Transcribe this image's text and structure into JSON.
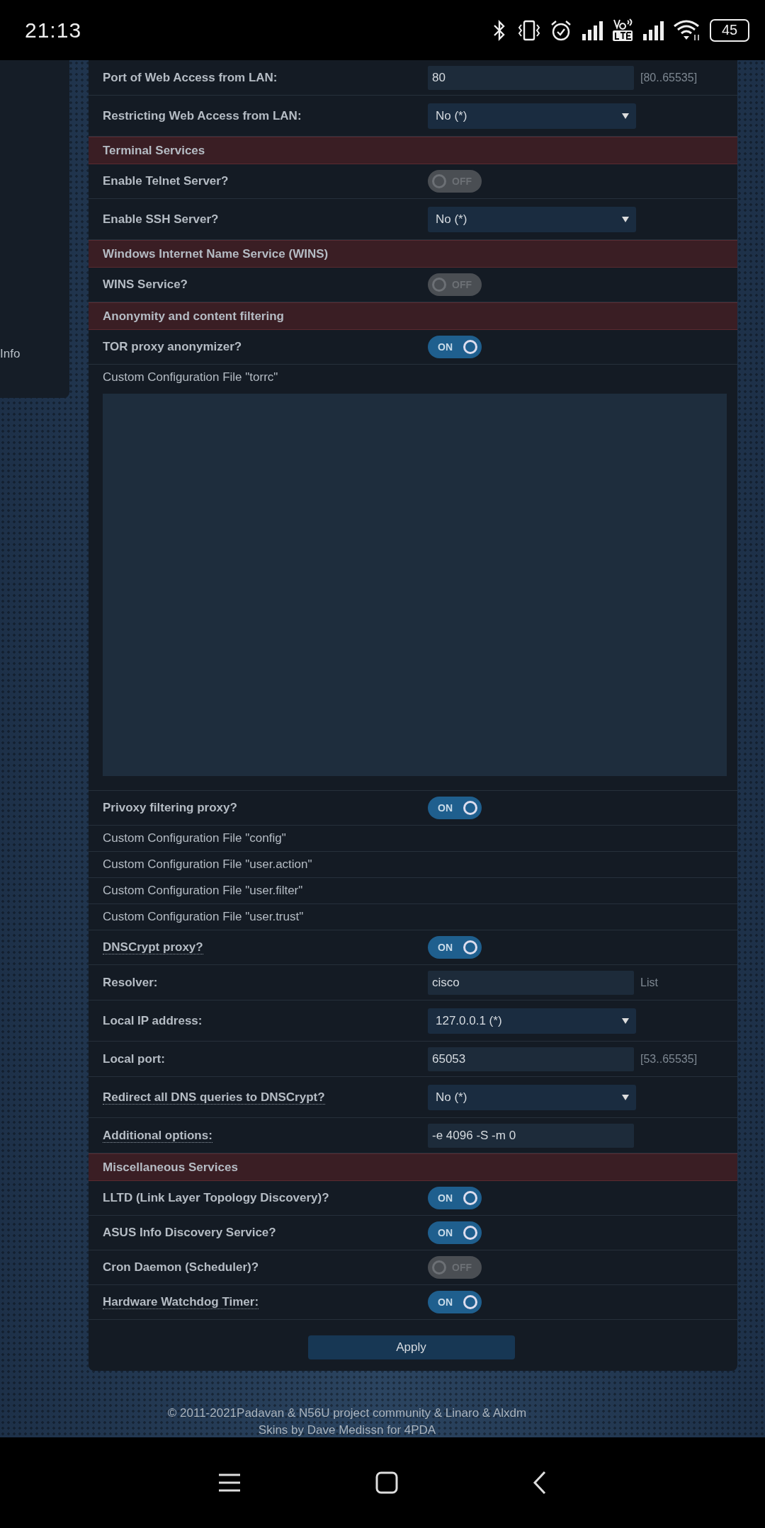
{
  "status_bar": {
    "time": "21:13",
    "battery": "45"
  },
  "sidebar": {
    "items": [
      {
        "label": "Info"
      }
    ]
  },
  "rows": [
    {
      "kind": "input",
      "label": "Port of Web Access from LAN:",
      "value": "80",
      "hint": "[80..65535]",
      "help": false
    },
    {
      "kind": "select",
      "label": "Restricting Web Access from LAN:",
      "value": "No (*)",
      "help": false
    },
    {
      "kind": "header",
      "label": "Terminal Services"
    },
    {
      "kind": "toggle",
      "label": "Enable Telnet Server?",
      "on": false,
      "text": "OFF",
      "help": false
    },
    {
      "kind": "select",
      "label": "Enable SSH Server?",
      "value": "No (*)",
      "help": false
    },
    {
      "kind": "header",
      "label": "Windows Internet Name Service (WINS)"
    },
    {
      "kind": "toggle",
      "label": "WINS Service?",
      "on": false,
      "text": "OFF",
      "help": false
    },
    {
      "kind": "header",
      "label": "Anonymity and content filtering"
    },
    {
      "kind": "toggle",
      "label": "TOR proxy anonymizer?",
      "on": true,
      "text": "ON",
      "help": false
    },
    {
      "kind": "textarea",
      "label": "Custom Configuration File \"torrc\""
    },
    {
      "kind": "toggle",
      "label": "Privoxy filtering proxy?",
      "on": true,
      "text": "ON",
      "help": false
    },
    {
      "kind": "file",
      "label": "Custom Configuration File \"config\""
    },
    {
      "kind": "file",
      "label": "Custom Configuration File \"user.action\""
    },
    {
      "kind": "file",
      "label": "Custom Configuration File \"user.filter\""
    },
    {
      "kind": "file",
      "label": "Custom Configuration File \"user.trust\""
    },
    {
      "kind": "toggle",
      "label": "DNSCrypt proxy?",
      "on": true,
      "text": "ON",
      "help": true
    },
    {
      "kind": "input",
      "label": "Resolver:",
      "value": "cisco",
      "hint": "List",
      "help": false
    },
    {
      "kind": "select",
      "label": "Local IP address:",
      "value": "127.0.0.1 (*)",
      "help": false
    },
    {
      "kind": "input",
      "label": "Local port:",
      "value": "65053",
      "hint": "[53..65535]",
      "help": false
    },
    {
      "kind": "select",
      "label": "Redirect all DNS queries to DNSCrypt?",
      "value": "No (*)",
      "help": true
    },
    {
      "kind": "input",
      "label": "Additional options:",
      "value": "-e 4096 -S -m 0",
      "help": true
    },
    {
      "kind": "header",
      "label": "Miscellaneous Services"
    },
    {
      "kind": "toggle",
      "label": "LLTD (Link Layer Topology Discovery)?",
      "on": true,
      "text": "ON",
      "help": false
    },
    {
      "kind": "toggle",
      "label": "ASUS Info Discovery Service?",
      "on": true,
      "text": "ON",
      "help": false
    },
    {
      "kind": "toggle",
      "label": "Cron Daemon (Scheduler)?",
      "on": false,
      "text": "OFF",
      "help": false
    },
    {
      "kind": "toggle",
      "label": "Hardware Watchdog Timer:",
      "on": true,
      "text": "ON",
      "help": true
    }
  ],
  "apply_button": "Apply",
  "footer": [
    "© 2011-2021Padavan & N56U project community & Linaro & Alxdm",
    "Skins by Dave Medissn for 4PDA"
  ]
}
